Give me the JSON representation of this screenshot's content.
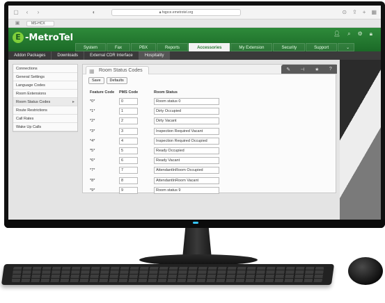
{
  "browser": {
    "url": "hqpce.emetrotel.org",
    "tab_label": "MS-HCX"
  },
  "app": {
    "logo_letter": "E",
    "logo_text": "-MetroTel",
    "header_icons": [
      "user-icon",
      "search-icon",
      "wrench-icon",
      "lock-icon"
    ]
  },
  "main_nav": {
    "tabs": [
      {
        "label": "System"
      },
      {
        "label": "Fax"
      },
      {
        "label": "PBX"
      },
      {
        "label": "Reports"
      },
      {
        "label": "Accessories"
      },
      {
        "label": "My Extension"
      },
      {
        "label": "Security"
      },
      {
        "label": "Support"
      }
    ],
    "active": "Accessories"
  },
  "sub_nav": {
    "items": [
      {
        "label": "Addon Packages"
      },
      {
        "label": "Downloads"
      },
      {
        "label": "External CDR Interface"
      },
      {
        "label": "Hospitality"
      }
    ],
    "active": "Hospitality"
  },
  "sidebar": {
    "items": [
      {
        "label": "Connections"
      },
      {
        "label": "General Settings"
      },
      {
        "label": "Language Codes"
      },
      {
        "label": "Room Extensions"
      },
      {
        "label": "Room Status Codes"
      },
      {
        "label": "Route Restrictions"
      },
      {
        "label": "Call Rates"
      },
      {
        "label": "Wake Up Calls"
      }
    ],
    "active": "Room Status Codes"
  },
  "panel": {
    "title": "Room Status Codes",
    "save_label": "Save",
    "defaults_label": "Defaults",
    "actions": [
      "edit-icon",
      "pin-icon",
      "star-icon",
      "help-icon"
    ],
    "columns": {
      "feature_code": "Feature Code",
      "pms_code": "PMS Code",
      "room_status": "Room Status"
    },
    "rows": [
      {
        "fc": "*0*",
        "pms": "0",
        "status": "Room status 0"
      },
      {
        "fc": "*1*",
        "pms": "1",
        "status": "Dirty Occupied"
      },
      {
        "fc": "*2*",
        "pms": "2",
        "status": "Dirty Vacant"
      },
      {
        "fc": "*3*",
        "pms": "3",
        "status": "Inspection Required Vacant"
      },
      {
        "fc": "*4*",
        "pms": "4",
        "status": "Inspection Required Occupied"
      },
      {
        "fc": "*5*",
        "pms": "5",
        "status": "Ready Occupied"
      },
      {
        "fc": "*6*",
        "pms": "6",
        "status": "Ready Vacant"
      },
      {
        "fc": "*7*",
        "pms": "7",
        "status": "AttendantInRoom Occupied"
      },
      {
        "fc": "*8*",
        "pms": "8",
        "status": "AttendantInRoom Vacant"
      },
      {
        "fc": "*9*",
        "pms": "9",
        "status": "Room status 9"
      }
    ]
  },
  "colors": {
    "brand_green": "#2e8a3a",
    "logo_green": "#7fcf3a",
    "power_led": "#36c6ff"
  }
}
